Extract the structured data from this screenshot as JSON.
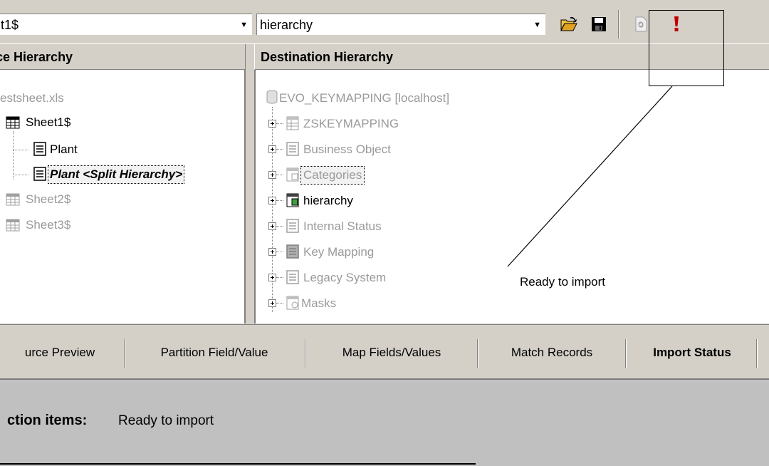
{
  "toolbar": {
    "source_combo": "t1$",
    "destination_combo": "hierarchy",
    "open_icon": "open-folder-icon",
    "save_icon": "floppy-disk-icon",
    "refresh_icon": "refresh-icon",
    "import_icon": "exclamation-icon"
  },
  "source_pane": {
    "header": "ce Hierarchy",
    "items": [
      {
        "label": "estsheet.xls"
      },
      {
        "label": "Sheet1$"
      },
      {
        "label": "Plant"
      },
      {
        "label": "Plant <Split Hierarchy>"
      },
      {
        "label": "Sheet2$"
      },
      {
        "label": "Sheet3$"
      }
    ]
  },
  "destination_pane": {
    "header": "Destination Hierarchy",
    "root": "EVO_KEYMAPPING [localhost]",
    "items": [
      {
        "label": "ZSKEYMAPPING"
      },
      {
        "label": "Business Object"
      },
      {
        "label": "Categories"
      },
      {
        "label": "hierarchy"
      },
      {
        "label": "Internal Status"
      },
      {
        "label": "Key Mapping"
      },
      {
        "label": "Legacy System"
      },
      {
        "label": "Masks"
      }
    ]
  },
  "callout": {
    "text": "Ready to import"
  },
  "tabs": [
    {
      "label": "urce Preview"
    },
    {
      "label": "Partition Field/Value"
    },
    {
      "label": "Map Fields/Values"
    },
    {
      "label": "Match Records"
    },
    {
      "label": "Import Status"
    }
  ],
  "status": {
    "label": "ction items:",
    "value": "Ready to import"
  },
  "colors": {
    "window_bg": "#d4d0c8",
    "disabled_text": "#9a9a9a",
    "import_red": "#c00000"
  }
}
